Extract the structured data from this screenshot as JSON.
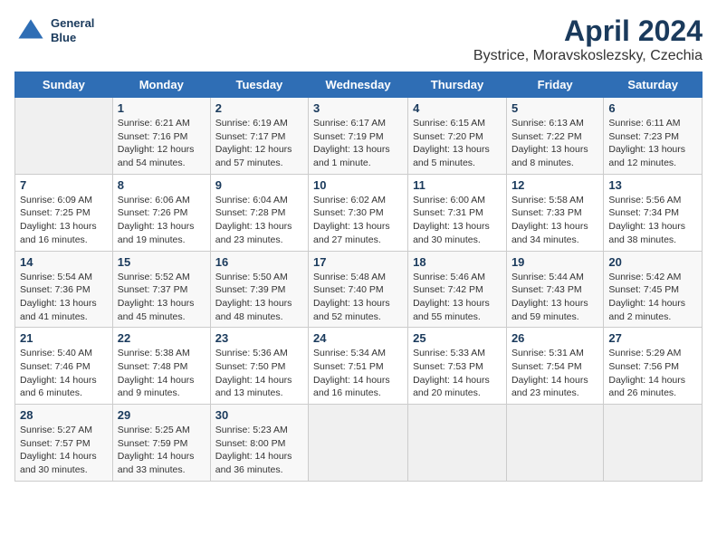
{
  "logo": {
    "line1": "General",
    "line2": "Blue"
  },
  "title": "April 2024",
  "subtitle": "Bystrice, Moravskoslezsky, Czechia",
  "days_of_week": [
    "Sunday",
    "Monday",
    "Tuesday",
    "Wednesday",
    "Thursday",
    "Friday",
    "Saturday"
  ],
  "weeks": [
    [
      {
        "day": "",
        "sunrise": "",
        "sunset": "",
        "daylight": ""
      },
      {
        "day": "1",
        "sunrise": "Sunrise: 6:21 AM",
        "sunset": "Sunset: 7:16 PM",
        "daylight": "Daylight: 12 hours and 54 minutes."
      },
      {
        "day": "2",
        "sunrise": "Sunrise: 6:19 AM",
        "sunset": "Sunset: 7:17 PM",
        "daylight": "Daylight: 12 hours and 57 minutes."
      },
      {
        "day": "3",
        "sunrise": "Sunrise: 6:17 AM",
        "sunset": "Sunset: 7:19 PM",
        "daylight": "Daylight: 13 hours and 1 minute."
      },
      {
        "day": "4",
        "sunrise": "Sunrise: 6:15 AM",
        "sunset": "Sunset: 7:20 PM",
        "daylight": "Daylight: 13 hours and 5 minutes."
      },
      {
        "day": "5",
        "sunrise": "Sunrise: 6:13 AM",
        "sunset": "Sunset: 7:22 PM",
        "daylight": "Daylight: 13 hours and 8 minutes."
      },
      {
        "day": "6",
        "sunrise": "Sunrise: 6:11 AM",
        "sunset": "Sunset: 7:23 PM",
        "daylight": "Daylight: 13 hours and 12 minutes."
      }
    ],
    [
      {
        "day": "7",
        "sunrise": "Sunrise: 6:09 AM",
        "sunset": "Sunset: 7:25 PM",
        "daylight": "Daylight: 13 hours and 16 minutes."
      },
      {
        "day": "8",
        "sunrise": "Sunrise: 6:06 AM",
        "sunset": "Sunset: 7:26 PM",
        "daylight": "Daylight: 13 hours and 19 minutes."
      },
      {
        "day": "9",
        "sunrise": "Sunrise: 6:04 AM",
        "sunset": "Sunset: 7:28 PM",
        "daylight": "Daylight: 13 hours and 23 minutes."
      },
      {
        "day": "10",
        "sunrise": "Sunrise: 6:02 AM",
        "sunset": "Sunset: 7:30 PM",
        "daylight": "Daylight: 13 hours and 27 minutes."
      },
      {
        "day": "11",
        "sunrise": "Sunrise: 6:00 AM",
        "sunset": "Sunset: 7:31 PM",
        "daylight": "Daylight: 13 hours and 30 minutes."
      },
      {
        "day": "12",
        "sunrise": "Sunrise: 5:58 AM",
        "sunset": "Sunset: 7:33 PM",
        "daylight": "Daylight: 13 hours and 34 minutes."
      },
      {
        "day": "13",
        "sunrise": "Sunrise: 5:56 AM",
        "sunset": "Sunset: 7:34 PM",
        "daylight": "Daylight: 13 hours and 38 minutes."
      }
    ],
    [
      {
        "day": "14",
        "sunrise": "Sunrise: 5:54 AM",
        "sunset": "Sunset: 7:36 PM",
        "daylight": "Daylight: 13 hours and 41 minutes."
      },
      {
        "day": "15",
        "sunrise": "Sunrise: 5:52 AM",
        "sunset": "Sunset: 7:37 PM",
        "daylight": "Daylight: 13 hours and 45 minutes."
      },
      {
        "day": "16",
        "sunrise": "Sunrise: 5:50 AM",
        "sunset": "Sunset: 7:39 PM",
        "daylight": "Daylight: 13 hours and 48 minutes."
      },
      {
        "day": "17",
        "sunrise": "Sunrise: 5:48 AM",
        "sunset": "Sunset: 7:40 PM",
        "daylight": "Daylight: 13 hours and 52 minutes."
      },
      {
        "day": "18",
        "sunrise": "Sunrise: 5:46 AM",
        "sunset": "Sunset: 7:42 PM",
        "daylight": "Daylight: 13 hours and 55 minutes."
      },
      {
        "day": "19",
        "sunrise": "Sunrise: 5:44 AM",
        "sunset": "Sunset: 7:43 PM",
        "daylight": "Daylight: 13 hours and 59 minutes."
      },
      {
        "day": "20",
        "sunrise": "Sunrise: 5:42 AM",
        "sunset": "Sunset: 7:45 PM",
        "daylight": "Daylight: 14 hours and 2 minutes."
      }
    ],
    [
      {
        "day": "21",
        "sunrise": "Sunrise: 5:40 AM",
        "sunset": "Sunset: 7:46 PM",
        "daylight": "Daylight: 14 hours and 6 minutes."
      },
      {
        "day": "22",
        "sunrise": "Sunrise: 5:38 AM",
        "sunset": "Sunset: 7:48 PM",
        "daylight": "Daylight: 14 hours and 9 minutes."
      },
      {
        "day": "23",
        "sunrise": "Sunrise: 5:36 AM",
        "sunset": "Sunset: 7:50 PM",
        "daylight": "Daylight: 14 hours and 13 minutes."
      },
      {
        "day": "24",
        "sunrise": "Sunrise: 5:34 AM",
        "sunset": "Sunset: 7:51 PM",
        "daylight": "Daylight: 14 hours and 16 minutes."
      },
      {
        "day": "25",
        "sunrise": "Sunrise: 5:33 AM",
        "sunset": "Sunset: 7:53 PM",
        "daylight": "Daylight: 14 hours and 20 minutes."
      },
      {
        "day": "26",
        "sunrise": "Sunrise: 5:31 AM",
        "sunset": "Sunset: 7:54 PM",
        "daylight": "Daylight: 14 hours and 23 minutes."
      },
      {
        "day": "27",
        "sunrise": "Sunrise: 5:29 AM",
        "sunset": "Sunset: 7:56 PM",
        "daylight": "Daylight: 14 hours and 26 minutes."
      }
    ],
    [
      {
        "day": "28",
        "sunrise": "Sunrise: 5:27 AM",
        "sunset": "Sunset: 7:57 PM",
        "daylight": "Daylight: 14 hours and 30 minutes."
      },
      {
        "day": "29",
        "sunrise": "Sunrise: 5:25 AM",
        "sunset": "Sunset: 7:59 PM",
        "daylight": "Daylight: 14 hours and 33 minutes."
      },
      {
        "day": "30",
        "sunrise": "Sunrise: 5:23 AM",
        "sunset": "Sunset: 8:00 PM",
        "daylight": "Daylight: 14 hours and 36 minutes."
      },
      {
        "day": "",
        "sunrise": "",
        "sunset": "",
        "daylight": ""
      },
      {
        "day": "",
        "sunrise": "",
        "sunset": "",
        "daylight": ""
      },
      {
        "day": "",
        "sunrise": "",
        "sunset": "",
        "daylight": ""
      },
      {
        "day": "",
        "sunrise": "",
        "sunset": "",
        "daylight": ""
      }
    ]
  ]
}
